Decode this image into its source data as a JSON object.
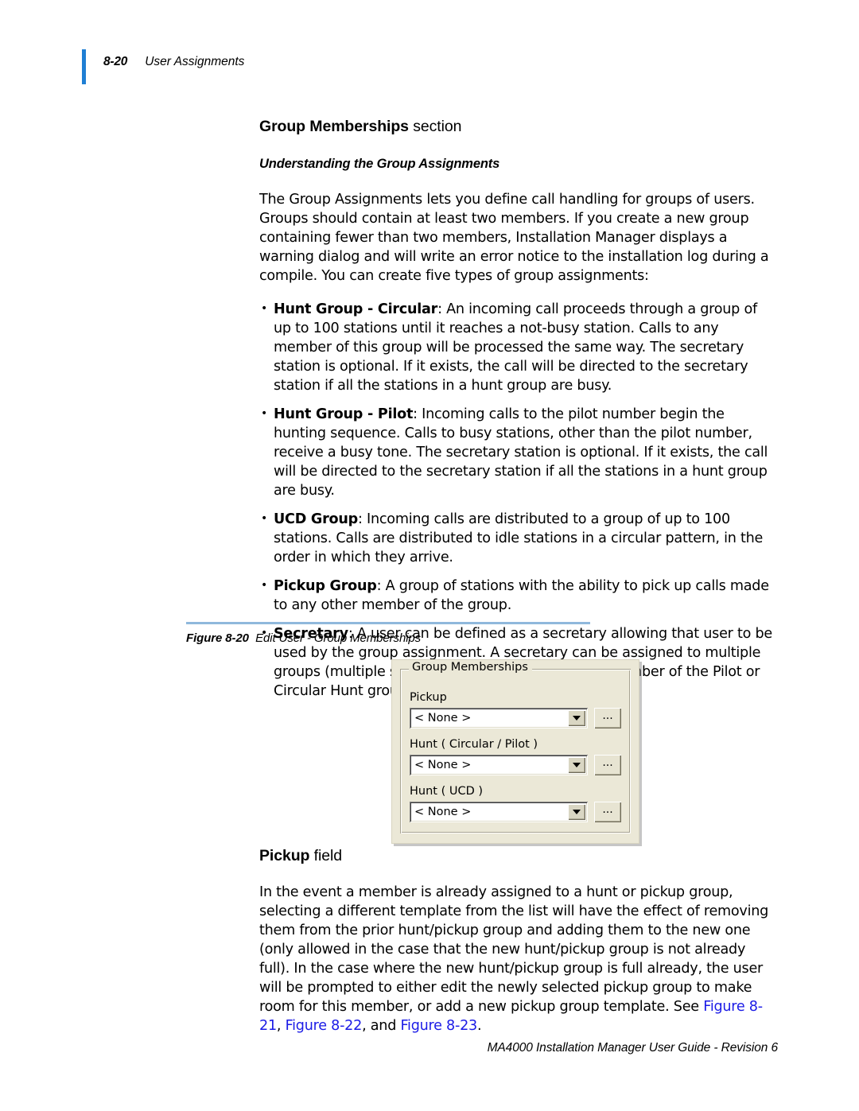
{
  "header": {
    "folio": "8-20",
    "title": "User Assignments"
  },
  "section": {
    "heading_strong": "Group Memberships",
    "heading_rest": " section",
    "subheading": "Understanding the Group Assignments",
    "intro": "The Group Assignments lets you define call handling for groups of users. Groups should contain at least two members. If you create a new group containing fewer than two members, Installation Manager displays a warning dialog and will write an error notice to the installation log during a compile. You can create five types of group assignments:",
    "bullets": [
      {
        "lead": "Hunt Group - Circular",
        "text": ": An incoming call proceeds through a group of up to 100 stations until it reaches a not-busy station. Calls to any member of this group will be processed the same way. The secretary station is optional. If it exists, the call will be directed to the secretary station if all the stations in a hunt group are busy."
      },
      {
        "lead": "Hunt Group - Pilot",
        "text": ": Incoming calls to the pilot number begin the hunting sequence. Calls to busy stations, other than the pilot number, receive a busy tone. The secretary station is optional. If it exists, the call will be directed to the secretary station if all the stations in a hunt group are busy."
      },
      {
        "lead": "UCD Group",
        "text": ": Incoming calls are distributed to a group of up to 100 stations. Calls are distributed to idle stations in a circular pattern, in the order in which they arrive."
      },
      {
        "lead": "Pickup Group",
        "text": ": A group of stations with the ability to pick up calls made to any other member of the group."
      },
      {
        "lead": "Secretary",
        "text": ": A user can be defined as a secretary allowing that user to be used by the group assignment. A secretary can be assigned to multiple groups (multiple secretary feature), but not as a member of the Pilot or Circular Hunt groups."
      }
    ]
  },
  "figure": {
    "label": "Figure 8-20",
    "caption": "Edit User - Group Memberships",
    "rule_color": "#8fb8dc"
  },
  "dialog": {
    "groupbox_legend": "Group Memberships",
    "fields": [
      {
        "label": "Pickup",
        "value": "< None >",
        "browse_label": "...",
        "arrow_icon": "chevron-down-icon"
      },
      {
        "label": "Hunt ( Circular / Pilot )",
        "value": "< None >",
        "browse_label": "...",
        "arrow_icon": "chevron-down-icon"
      },
      {
        "label": "Hunt ( UCD )",
        "value": "< None >",
        "browse_label": "...",
        "arrow_icon": "chevron-down-icon"
      }
    ]
  },
  "pickup_field": {
    "heading_strong": "Pickup",
    "heading_rest": " field",
    "body_part1": "In the event a member is already assigned to a hunt or pickup group, selecting a different template from the list will have the effect of removing them from the prior hunt/pickup group and adding them to the new one (only allowed in the case that the new hunt/pickup group is not already full). In the case where the new hunt/pickup group is full already, the user will be prompted to either edit the newly selected pickup group to make room for this member, or add a new pickup group template. See ",
    "xref1": "Figure 8-21",
    "between1": ", ",
    "xref2": "Figure 8-22",
    "between2": ", and ",
    "xref3": "Figure 8-23",
    "body_end": "."
  },
  "footer": {
    "text": "MA4000 Installation Manager User Guide - Revision 6"
  },
  "colors": {
    "header_rule": "#1f7fd4",
    "figure_rule": "#8fb8dc",
    "xref_link": "#1a1ae6",
    "dialog_face": "#ebe8d7"
  }
}
